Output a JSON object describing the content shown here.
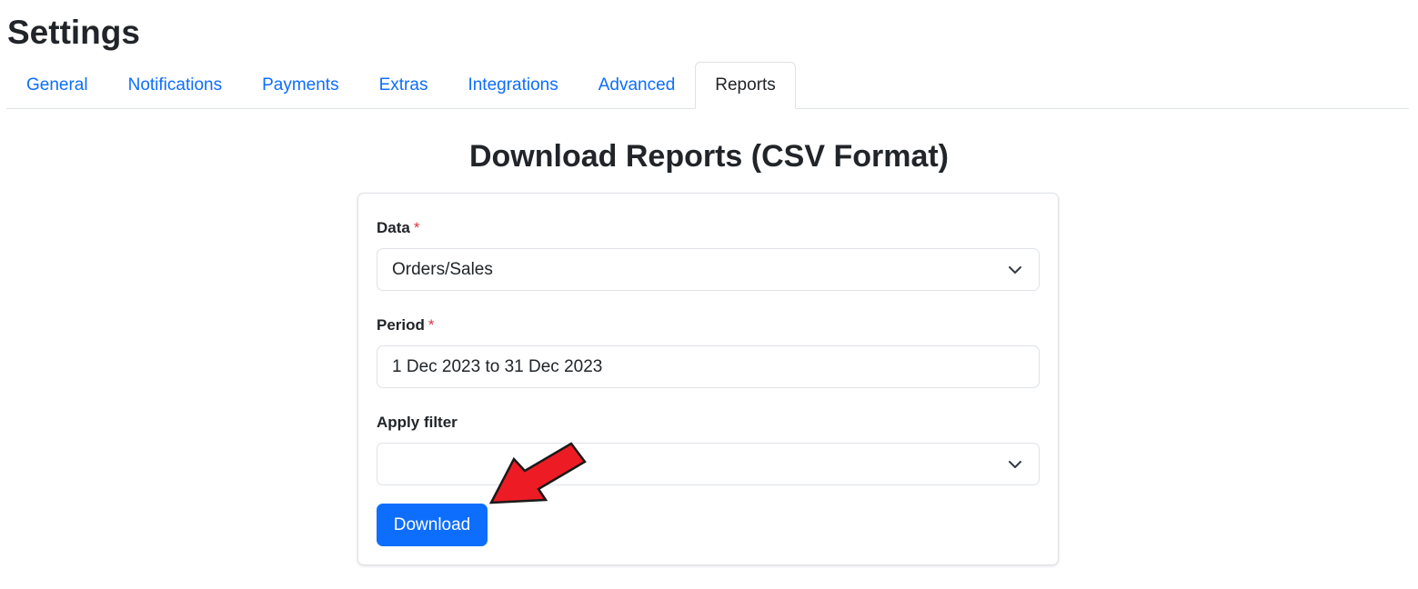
{
  "page": {
    "title": "Settings"
  },
  "tabs": [
    {
      "label": "General",
      "active": false
    },
    {
      "label": "Notifications",
      "active": false
    },
    {
      "label": "Payments",
      "active": false
    },
    {
      "label": "Extras",
      "active": false
    },
    {
      "label": "Integrations",
      "active": false
    },
    {
      "label": "Advanced",
      "active": false
    },
    {
      "label": "Reports",
      "active": true
    }
  ],
  "reports": {
    "heading": "Download Reports (CSV Format)",
    "data_field": {
      "label": "Data",
      "required_marker": "*",
      "value": "Orders/Sales"
    },
    "period_field": {
      "label": "Period",
      "required_marker": "*",
      "value": "1 Dec 2023 to 31 Dec 2023"
    },
    "filter_field": {
      "label": "Apply filter",
      "value": ""
    },
    "download_label": "Download"
  },
  "annotation": {
    "icon": "red-arrow-icon",
    "color": "#ed1c24",
    "points_to": "download-button"
  },
  "colors": {
    "link": "#0d6efd",
    "primary_button": "#0d6efd",
    "required": "#dc3545",
    "text": "#212529",
    "border": "#dee2e6"
  }
}
